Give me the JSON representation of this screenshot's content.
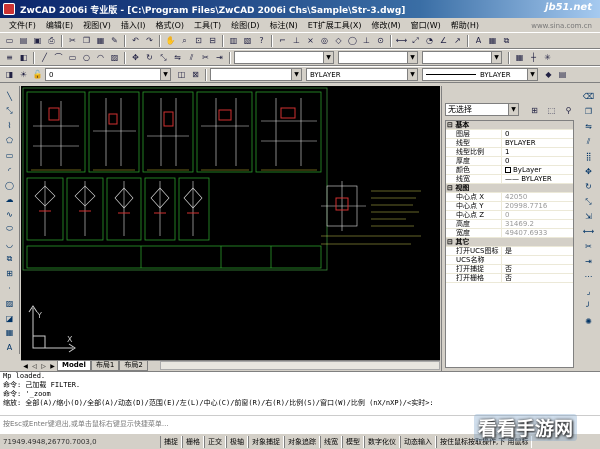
{
  "window": {
    "title": "ZwCAD 2006i 专业版 - [C:\\Program Files\\ZwCAD 2006i Chs\\Sample\\Str-3.dwg]",
    "watermark": "jb51.net",
    "watermark_url": "www.sina.com.cn"
  },
  "menu": [
    "文件(F)",
    "编辑(E)",
    "视图(V)",
    "插入(I)",
    "格式(O)",
    "工具(T)",
    "绘图(D)",
    "标注(N)",
    "ET扩展工具(X)",
    "修改(M)",
    "窗口(W)",
    "帮助(H)"
  ],
  "layer_combo": "0",
  "color_combo": "BYLAYER",
  "linetype_combo": "BYLAYER",
  "tabs": [
    "Model",
    "布局1",
    "布局2"
  ],
  "properties": {
    "selection": "无选择",
    "categories": [
      {
        "name": "基本",
        "rows": [
          [
            "图层",
            "0"
          ],
          [
            "线型",
            "BYLAYER"
          ],
          [
            "线型比例",
            "1"
          ],
          [
            "厚度",
            "0"
          ],
          [
            "颜色",
            "ByLayer"
          ],
          [
            "线宽",
            "—— BYLAYER"
          ]
        ]
      },
      {
        "name": "视图",
        "rows": [
          [
            "中心点 X",
            "42050"
          ],
          [
            "中心点 Y",
            "20998.7716"
          ],
          [
            "中心点 Z",
            "0"
          ],
          [
            "高度",
            "31469.2"
          ],
          [
            "宽度",
            "49407.6933"
          ]
        ]
      },
      {
        "name": "其它",
        "rows": [
          [
            "打开UCS图标",
            "是"
          ],
          [
            "UCS名称",
            ""
          ],
          [
            "打开捕捉",
            "否"
          ],
          [
            "打开栅格",
            "否"
          ]
        ]
      }
    ]
  },
  "command": {
    "lines": [
      "Mp loaded.",
      "命令:  己加载 FILTER.",
      "命令: '_zoom",
      "缩放: 全部(A)/缩小(O)/全部(A)/动态(D)/范围(E)/左(L)/中心(C)/前窗(R)/右(R)/比例(S)/窗口(W)/比例 (nX/nXP)/<实时>:"
    ],
    "help": "按Esc或Enter键退出,或单击鼠标右键显示快捷菜单..."
  },
  "status": {
    "coords": "71949.4948,26770.7003,0",
    "buttons": [
      "捕捉",
      "栅格",
      "正交",
      "极轴",
      "对象捕捉",
      "对象追踪",
      "线宽",
      "模型",
      "数字化仪",
      "动态输入"
    ],
    "message": "按住鼠标按取操作,下 用鼠标"
  },
  "logo": "看看手游网",
  "colors": {
    "title_start": "#0a246a",
    "canvas": "#000000",
    "drawing": "#00b000"
  }
}
